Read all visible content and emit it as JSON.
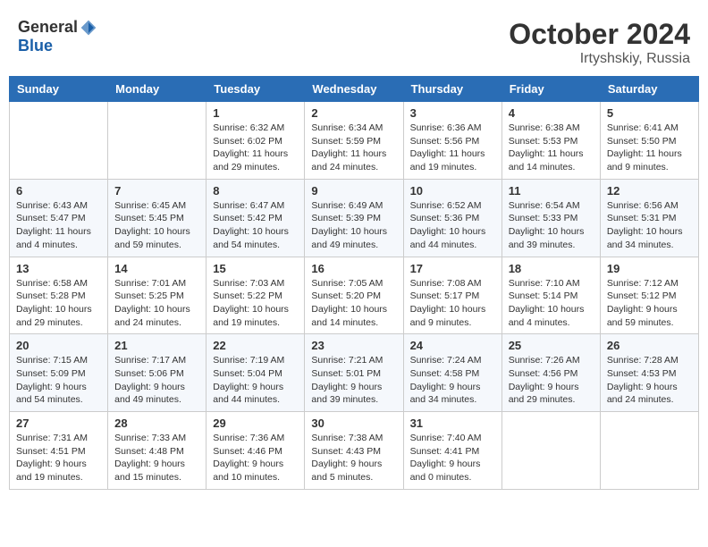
{
  "header": {
    "logo_general": "General",
    "logo_blue": "Blue",
    "month": "October 2024",
    "location": "Irtyshskiy, Russia"
  },
  "weekdays": [
    "Sunday",
    "Monday",
    "Tuesday",
    "Wednesday",
    "Thursday",
    "Friday",
    "Saturday"
  ],
  "weeks": [
    [
      {
        "day": "",
        "content": ""
      },
      {
        "day": "",
        "content": ""
      },
      {
        "day": "1",
        "content": "Sunrise: 6:32 AM\nSunset: 6:02 PM\nDaylight: 11 hours and 29 minutes."
      },
      {
        "day": "2",
        "content": "Sunrise: 6:34 AM\nSunset: 5:59 PM\nDaylight: 11 hours and 24 minutes."
      },
      {
        "day": "3",
        "content": "Sunrise: 6:36 AM\nSunset: 5:56 PM\nDaylight: 11 hours and 19 minutes."
      },
      {
        "day": "4",
        "content": "Sunrise: 6:38 AM\nSunset: 5:53 PM\nDaylight: 11 hours and 14 minutes."
      },
      {
        "day": "5",
        "content": "Sunrise: 6:41 AM\nSunset: 5:50 PM\nDaylight: 11 hours and 9 minutes."
      }
    ],
    [
      {
        "day": "6",
        "content": "Sunrise: 6:43 AM\nSunset: 5:47 PM\nDaylight: 11 hours and 4 minutes."
      },
      {
        "day": "7",
        "content": "Sunrise: 6:45 AM\nSunset: 5:45 PM\nDaylight: 10 hours and 59 minutes."
      },
      {
        "day": "8",
        "content": "Sunrise: 6:47 AM\nSunset: 5:42 PM\nDaylight: 10 hours and 54 minutes."
      },
      {
        "day": "9",
        "content": "Sunrise: 6:49 AM\nSunset: 5:39 PM\nDaylight: 10 hours and 49 minutes."
      },
      {
        "day": "10",
        "content": "Sunrise: 6:52 AM\nSunset: 5:36 PM\nDaylight: 10 hours and 44 minutes."
      },
      {
        "day": "11",
        "content": "Sunrise: 6:54 AM\nSunset: 5:33 PM\nDaylight: 10 hours and 39 minutes."
      },
      {
        "day": "12",
        "content": "Sunrise: 6:56 AM\nSunset: 5:31 PM\nDaylight: 10 hours and 34 minutes."
      }
    ],
    [
      {
        "day": "13",
        "content": "Sunrise: 6:58 AM\nSunset: 5:28 PM\nDaylight: 10 hours and 29 minutes."
      },
      {
        "day": "14",
        "content": "Sunrise: 7:01 AM\nSunset: 5:25 PM\nDaylight: 10 hours and 24 minutes."
      },
      {
        "day": "15",
        "content": "Sunrise: 7:03 AM\nSunset: 5:22 PM\nDaylight: 10 hours and 19 minutes."
      },
      {
        "day": "16",
        "content": "Sunrise: 7:05 AM\nSunset: 5:20 PM\nDaylight: 10 hours and 14 minutes."
      },
      {
        "day": "17",
        "content": "Sunrise: 7:08 AM\nSunset: 5:17 PM\nDaylight: 10 hours and 9 minutes."
      },
      {
        "day": "18",
        "content": "Sunrise: 7:10 AM\nSunset: 5:14 PM\nDaylight: 10 hours and 4 minutes."
      },
      {
        "day": "19",
        "content": "Sunrise: 7:12 AM\nSunset: 5:12 PM\nDaylight: 9 hours and 59 minutes."
      }
    ],
    [
      {
        "day": "20",
        "content": "Sunrise: 7:15 AM\nSunset: 5:09 PM\nDaylight: 9 hours and 54 minutes."
      },
      {
        "day": "21",
        "content": "Sunrise: 7:17 AM\nSunset: 5:06 PM\nDaylight: 9 hours and 49 minutes."
      },
      {
        "day": "22",
        "content": "Sunrise: 7:19 AM\nSunset: 5:04 PM\nDaylight: 9 hours and 44 minutes."
      },
      {
        "day": "23",
        "content": "Sunrise: 7:21 AM\nSunset: 5:01 PM\nDaylight: 9 hours and 39 minutes."
      },
      {
        "day": "24",
        "content": "Sunrise: 7:24 AM\nSunset: 4:58 PM\nDaylight: 9 hours and 34 minutes."
      },
      {
        "day": "25",
        "content": "Sunrise: 7:26 AM\nSunset: 4:56 PM\nDaylight: 9 hours and 29 minutes."
      },
      {
        "day": "26",
        "content": "Sunrise: 7:28 AM\nSunset: 4:53 PM\nDaylight: 9 hours and 24 minutes."
      }
    ],
    [
      {
        "day": "27",
        "content": "Sunrise: 7:31 AM\nSunset: 4:51 PM\nDaylight: 9 hours and 19 minutes."
      },
      {
        "day": "28",
        "content": "Sunrise: 7:33 AM\nSunset: 4:48 PM\nDaylight: 9 hours and 15 minutes."
      },
      {
        "day": "29",
        "content": "Sunrise: 7:36 AM\nSunset: 4:46 PM\nDaylight: 9 hours and 10 minutes."
      },
      {
        "day": "30",
        "content": "Sunrise: 7:38 AM\nSunset: 4:43 PM\nDaylight: 9 hours and 5 minutes."
      },
      {
        "day": "31",
        "content": "Sunrise: 7:40 AM\nSunset: 4:41 PM\nDaylight: 9 hours and 0 minutes."
      },
      {
        "day": "",
        "content": ""
      },
      {
        "day": "",
        "content": ""
      }
    ]
  ]
}
